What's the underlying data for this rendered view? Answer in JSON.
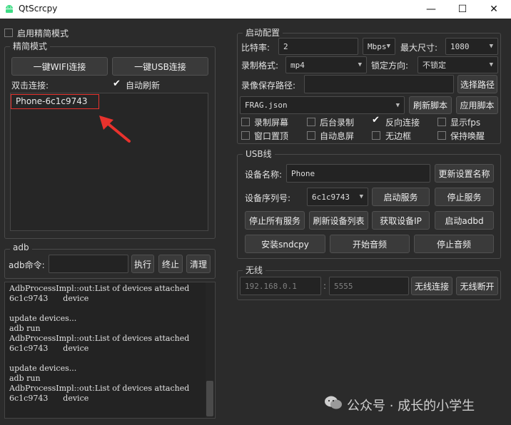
{
  "window": {
    "title": "QtScrcpy",
    "minimize": "—",
    "maximize": "☐",
    "close": "✕"
  },
  "simple_mode": {
    "checkbox_label": "启用精简模式",
    "group_title": "精简模式"
  },
  "simple": {
    "wifi_btn": "一键WIFI连接",
    "usb_btn": "一键USB连接",
    "dbl_label": "双击连接:",
    "auto_refresh": "自动刷新",
    "device_item": "Phone-6c1c9743"
  },
  "adb": {
    "group_title": "adb",
    "cmd_label": "adb命令:",
    "cmd_value": "",
    "exec_btn": "执行",
    "stop_btn": "终止",
    "clear_btn": "清理",
    "log": [
      "AdbProcessImpl::out:List of devices attached",
      "6c1c9743      device",
      "",
      "update devices...",
      "adb run",
      "AdbProcessImpl::out:List of devices attached",
      "6c1c9743      device",
      "",
      "update devices...",
      "adb run",
      "AdbProcessImpl::out:List of devices attached",
      "6c1c9743      device"
    ]
  },
  "start_config": {
    "group_title": "启动配置",
    "bitrate_label": "比特率:",
    "bitrate_value": "2",
    "bitrate_unit": "Mbps",
    "maxsize_label": "最大尺寸:",
    "maxsize_value": "1080",
    "rec_format_label": "录制格式:",
    "rec_format_value": "mp4",
    "lock_dir_label": "锁定方向:",
    "lock_dir_value": "不锁定",
    "save_path_label": "录像保存路径:",
    "save_path_value": "",
    "choose_path_btn": "选择路径",
    "script_value": "FRAG.json",
    "refresh_script_btn": "刷新脚本",
    "apply_script_btn": "应用脚本",
    "checks": [
      {
        "label": "录制屏幕",
        "checked": false
      },
      {
        "label": "后台录制",
        "checked": false
      },
      {
        "label": "反向连接",
        "checked": true
      },
      {
        "label": "显示fps",
        "checked": false
      },
      {
        "label": "窗口置顶",
        "checked": false
      },
      {
        "label": "自动息屏",
        "checked": false
      },
      {
        "label": "无边框",
        "checked": false
      },
      {
        "label": "保持唤醒",
        "checked": false
      }
    ]
  },
  "usb": {
    "group_title": "USB线",
    "device_name_label": "设备名称:",
    "device_name_value": "Phone",
    "update_name_btn": "更新设置名称",
    "serial_label": "设备序列号:",
    "serial_value": "6c1c9743",
    "start_service_btn": "启动服务",
    "stop_service_btn": "停止服务",
    "stop_all_btn": "停止所有服务",
    "refresh_devices_btn": "刷新设备列表",
    "get_ip_btn": "获取设备IP",
    "start_adbd_btn": "启动adbd",
    "install_sndcpy_btn": "安装sndcpy",
    "start_audio_btn": "开始音频",
    "stop_audio_btn": "停止音频"
  },
  "wireless": {
    "group_title": "无线",
    "ip_placeholder": "192.168.0.1",
    "separator": ":",
    "port_placeholder": "5555",
    "connect_btn": "无线连接",
    "disconnect_btn": "无线断开"
  },
  "watermark": {
    "text": "公众号 · 成长的小学生"
  },
  "colors": {
    "annotation_red": "#e8322d",
    "background": "#2b2b2b"
  }
}
